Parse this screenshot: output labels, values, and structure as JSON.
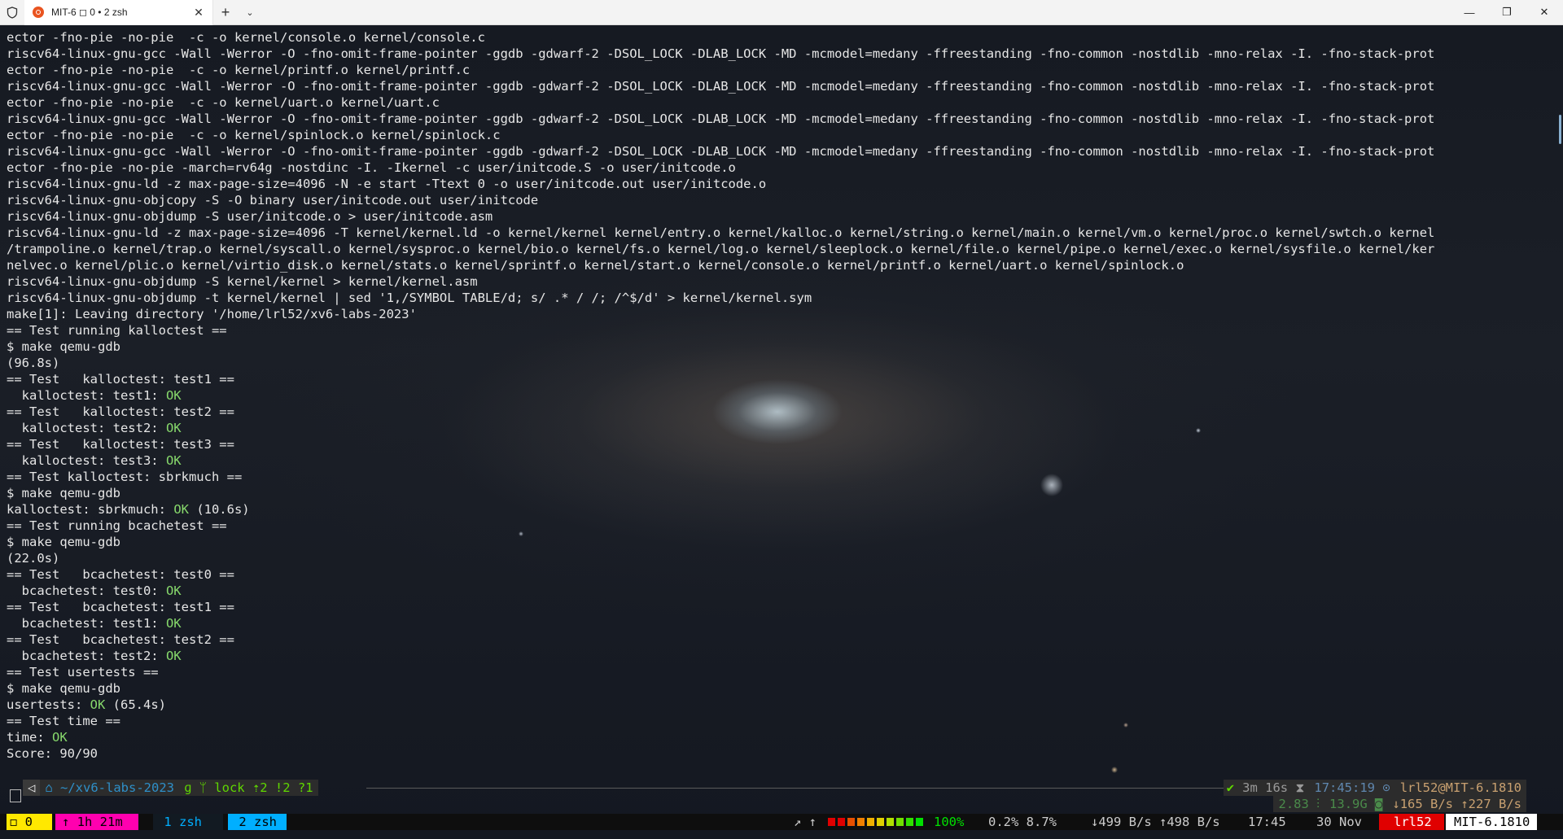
{
  "titlebar": {
    "tab_title": "MIT-6 ◻ 0 • 2 zsh",
    "new_tab": "+",
    "dropdown": "⌄",
    "close_tab": "✕",
    "minimize": "—",
    "maximize": "❐",
    "close_window": "✕"
  },
  "terminal": {
    "lines": [
      [
        {
          "t": "ector -fno-pie -no-pie  -c -o kernel/console.o kernel/console.c"
        }
      ],
      [
        {
          "t": "riscv64-linux-gnu-gcc -Wall -Werror -O -fno-omit-frame-pointer -ggdb -gdwarf-2 -DSOL_LOCK -DLAB_LOCK -MD -mcmodel=medany -ffreestanding -fno-common -nostdlib -mno-relax -I. -fno-stack-prot"
        }
      ],
      [
        {
          "t": "ector -fno-pie -no-pie  -c -o kernel/printf.o kernel/printf.c"
        }
      ],
      [
        {
          "t": "riscv64-linux-gnu-gcc -Wall -Werror -O -fno-omit-frame-pointer -ggdb -gdwarf-2 -DSOL_LOCK -DLAB_LOCK -MD -mcmodel=medany -ffreestanding -fno-common -nostdlib -mno-relax -I. -fno-stack-prot"
        }
      ],
      [
        {
          "t": "ector -fno-pie -no-pie  -c -o kernel/uart.o kernel/uart.c"
        }
      ],
      [
        {
          "t": "riscv64-linux-gnu-gcc -Wall -Werror -O -fno-omit-frame-pointer -ggdb -gdwarf-2 -DSOL_LOCK -DLAB_LOCK -MD -mcmodel=medany -ffreestanding -fno-common -nostdlib -mno-relax -I. -fno-stack-prot"
        }
      ],
      [
        {
          "t": "ector -fno-pie -no-pie  -c -o kernel/spinlock.o kernel/spinlock.c"
        }
      ],
      [
        {
          "t": "riscv64-linux-gnu-gcc -Wall -Werror -O -fno-omit-frame-pointer -ggdb -gdwarf-2 -DSOL_LOCK -DLAB_LOCK -MD -mcmodel=medany -ffreestanding -fno-common -nostdlib -mno-relax -I. -fno-stack-prot"
        }
      ],
      [
        {
          "t": "ector -fno-pie -no-pie -march=rv64g -nostdinc -I. -Ikernel -c user/initcode.S -o user/initcode.o"
        }
      ],
      [
        {
          "t": "riscv64-linux-gnu-ld -z max-page-size=4096 -N -e start -Ttext 0 -o user/initcode.out user/initcode.o"
        }
      ],
      [
        {
          "t": "riscv64-linux-gnu-objcopy -S -O binary user/initcode.out user/initcode"
        }
      ],
      [
        {
          "t": "riscv64-linux-gnu-objdump -S user/initcode.o > user/initcode.asm"
        }
      ],
      [
        {
          "t": "riscv64-linux-gnu-ld -z max-page-size=4096 -T kernel/kernel.ld -o kernel/kernel kernel/entry.o kernel/kalloc.o kernel/string.o kernel/main.o kernel/vm.o kernel/proc.o kernel/swtch.o kernel"
        }
      ],
      [
        {
          "t": "/trampoline.o kernel/trap.o kernel/syscall.o kernel/sysproc.o kernel/bio.o kernel/fs.o kernel/log.o kernel/sleeplock.o kernel/file.o kernel/pipe.o kernel/exec.o kernel/sysfile.o kernel/ker"
        }
      ],
      [
        {
          "t": "nelvec.o kernel/plic.o kernel/virtio_disk.o kernel/stats.o kernel/sprintf.o kernel/start.o kernel/console.o kernel/printf.o kernel/uart.o kernel/spinlock.o"
        }
      ],
      [
        {
          "t": "riscv64-linux-gnu-objdump -S kernel/kernel > kernel/kernel.asm"
        }
      ],
      [
        {
          "t": "riscv64-linux-gnu-objdump -t kernel/kernel | sed '1,/SYMBOL TABLE/d; s/ .* / /; /^$/d' > kernel/kernel.sym"
        }
      ],
      [
        {
          "t": "make[1]: Leaving directory '/home/lrl52/xv6-labs-2023'"
        }
      ],
      [
        {
          "t": "== Test running kalloctest =="
        }
      ],
      [
        {
          "t": "$ make qemu-gdb"
        }
      ],
      [
        {
          "t": "(96.8s)"
        }
      ],
      [
        {
          "t": "== Test   kalloctest: test1 =="
        }
      ],
      [
        {
          "t": "  kalloctest: test1: "
        },
        {
          "t": "OK",
          "c": "ok"
        }
      ],
      [
        {
          "t": "== Test   kalloctest: test2 =="
        }
      ],
      [
        {
          "t": "  kalloctest: test2: "
        },
        {
          "t": "OK",
          "c": "ok"
        }
      ],
      [
        {
          "t": "== Test   kalloctest: test3 =="
        }
      ],
      [
        {
          "t": "  kalloctest: test3: "
        },
        {
          "t": "OK",
          "c": "ok"
        }
      ],
      [
        {
          "t": "== Test kalloctest: sbrkmuch =="
        }
      ],
      [
        {
          "t": "$ make qemu-gdb"
        }
      ],
      [
        {
          "t": "kalloctest: sbrkmuch: "
        },
        {
          "t": "OK",
          "c": "ok"
        },
        {
          "t": " (10.6s)"
        }
      ],
      [
        {
          "t": "== Test running bcachetest =="
        }
      ],
      [
        {
          "t": "$ make qemu-gdb"
        }
      ],
      [
        {
          "t": "(22.0s)"
        }
      ],
      [
        {
          "t": "== Test   bcachetest: test0 =="
        }
      ],
      [
        {
          "t": "  bcachetest: test0: "
        },
        {
          "t": "OK",
          "c": "ok"
        }
      ],
      [
        {
          "t": "== Test   bcachetest: test1 =="
        }
      ],
      [
        {
          "t": "  bcachetest: test1: "
        },
        {
          "t": "OK",
          "c": "ok"
        }
      ],
      [
        {
          "t": "== Test   bcachetest: test2 =="
        }
      ],
      [
        {
          "t": "  bcachetest: test2: "
        },
        {
          "t": "OK",
          "c": "ok"
        }
      ],
      [
        {
          "t": "== Test usertests =="
        }
      ],
      [
        {
          "t": "$ make qemu-gdb"
        }
      ],
      [
        {
          "t": "usertests: "
        },
        {
          "t": "OK",
          "c": "ok"
        },
        {
          "t": " (65.4s)"
        }
      ],
      [
        {
          "t": "== Test time =="
        }
      ],
      [
        {
          "t": "time: "
        },
        {
          "t": "OK",
          "c": "ok"
        }
      ],
      [
        {
          "t": "Score: 90/90"
        }
      ]
    ]
  },
  "prompt": {
    "os_icon": "◁",
    "dir": "⌂ ~/xv6-labs-2023",
    "git": "ɡ ᛘ lock ⇡2 !2 ?1",
    "status_ok": "✔",
    "duration": "3m 16s ⧗",
    "time": "17:45:19 ⊙",
    "context": "lrl52@MIT-6.1810",
    "load": "2.83 ⫶",
    "ram": "13.9G ◙",
    "net": "↓165 B/s ↑227 B/s"
  },
  "tmux": {
    "session": "◻ 0",
    "uptime": "↑ 1h 21m",
    "win1": " 1 zsh ",
    "win2": " 2 zsh ",
    "arrows": "↗ ↑",
    "battery": "100%",
    "cpu": "0.2% 8.7%",
    "netspeed": "↓499 B/s ↑498 B/s",
    "clock": "17:45",
    "date": "30 Nov",
    "user": "lrl52",
    "host": "MIT-6.1810"
  },
  "colors": {
    "ok": "#87d96c",
    "tmux_yellow": "#ffe800",
    "tmux_magenta": "#ff00af",
    "tmux_cyan": "#00afff",
    "tmux_red": "#e00000",
    "git_green": "#5fd700",
    "dir_blue": "#2e8fc8"
  }
}
